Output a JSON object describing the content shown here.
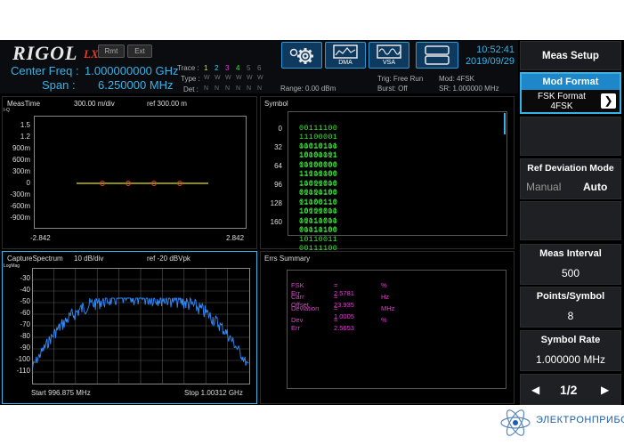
{
  "header": {
    "logo": "RIGOL",
    "lxi": "LXI",
    "rmt": "Rmt",
    "ext": "Ext",
    "center_freq_label": "Center Freq :",
    "center_freq_value": "1.000000000 GHz",
    "span_label": "Span :",
    "span_value": "6.250000 MHz",
    "trace_label": "Trace :",
    "trace_nums": [
      "1",
      "2",
      "3",
      "4",
      "5",
      "6"
    ],
    "type_label": "Type :",
    "type_vals": [
      "W",
      "W",
      "W",
      "W",
      "W",
      "W"
    ],
    "det_label": "Det :",
    "det_vals": [
      "N",
      "N",
      "N",
      "N",
      "N",
      "N"
    ],
    "range": "Range: 0.00 dBm",
    "trig": "Trig: Free Run",
    "burst": "Burst: Off",
    "mod": "Mod: 4FSK",
    "sr": "SR: 1.000000 MHz",
    "dma_label": "DMA",
    "vsa_label": "VSA",
    "time": "10:52:41",
    "date": "2019/09/29"
  },
  "meas_time": {
    "title": "MeasTime",
    "scale": "300.00 m/div",
    "ref": "ref 300.00 m",
    "ylabel": "I-Q",
    "y_ticks": [
      "1.5",
      "1.2",
      "900m",
      "600m",
      "300m",
      "0",
      "-300m",
      "-600m",
      "-900m"
    ],
    "x_start": "-2.842",
    "x_end": "2.842"
  },
  "symbol": {
    "title": "Symbol",
    "rows": [
      {
        "idx": "0",
        "bits": "00111100  11100001  11010111  10101101"
      },
      {
        "idx": "32",
        "bits": "00010100  10000011  01000000  11010100"
      },
      {
        "idx": "64",
        "bits": "10100000  11101000  11000010  00101100"
      },
      {
        "idx": "96",
        "bits": "10011000  01010100  01100110  10000011"
      },
      {
        "idx": "128",
        "bits": "11000110  10111000  10111011  01111100"
      },
      {
        "idx": "160",
        "bits": "01010000  00010100  10110011  00111100"
      }
    ]
  },
  "spectrum": {
    "title": "CaptureSpectrum",
    "scale": "10 dB/div",
    "ref": "ref -20 dBVpk",
    "ylabel": "LogMag",
    "y_ticks": [
      "-30",
      "-40",
      "-50",
      "-60",
      "-70",
      "-80",
      "-90",
      "-100",
      "-110"
    ],
    "start": "Start 996.875 MHz",
    "stop": "Stop 1.00312 GHz"
  },
  "errs": {
    "title": "Errs Summary",
    "rows": [
      {
        "name": "FSK Err",
        "value": "= 2.5781",
        "unit": "%"
      },
      {
        "name": "Carr Offset",
        "value": "= 23.935",
        "unit": "Hz"
      },
      {
        "name": "Deviation",
        "value": "= 1.0005",
        "unit": "MHz"
      },
      {
        "name": "Dev Err",
        "value": "= 2.5653",
        "unit": "%"
      }
    ]
  },
  "right_panel": {
    "title": "Meas Setup",
    "mod_format": "Mod Format",
    "fsk_format_line1": "FSK Format",
    "fsk_format_line2": "4FSK",
    "ref_dev_mode": "Ref Deviation Mode",
    "manual": "Manual",
    "auto": "Auto",
    "meas_interval": "Meas Interval",
    "meas_interval_value": "500",
    "points_symbol": "Points/Symbol",
    "points_symbol_value": "8",
    "symbol_rate": "Symbol Rate",
    "symbol_rate_value": "1.000000 MHz",
    "page": "1/2"
  },
  "brand": "ЭЛЕКТРОНПРИБОР",
  "colors": {
    "accent_blue": "#35b4e8",
    "symbol_green": "#3ee63e",
    "error_magenta": "#e040d0",
    "trace_yellow": "#e0e020",
    "spectrum_blue": "#2f8cff"
  }
}
